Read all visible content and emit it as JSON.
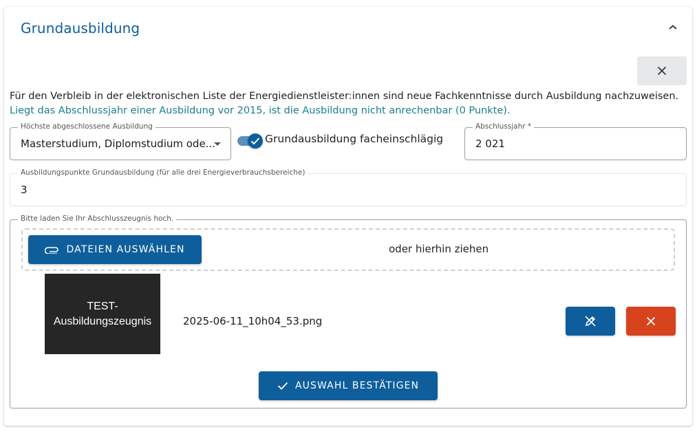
{
  "section": {
    "title": "Grundausbildung",
    "collapse_icon": "chevron-up-icon",
    "close_icon": "close-icon"
  },
  "info": {
    "line1": "Für den Verbleib in der elektronischen Liste der Energiedienstleister:innen sind neue Fachkenntnisse durch Ausbildung nachzuweisen.",
    "line2": "Liegt das Abschlussjahr einer Ausbildung vor 2015, ist die Ausbildung nicht anrechenbar (0 Punkte)."
  },
  "form": {
    "education": {
      "label": "Höchste abgeschlossene Ausbildung",
      "value": "Masterstudium, Diplomstudium ode..."
    },
    "relevant_toggle": {
      "label": "Grundausbildung facheinschlägig",
      "checked": true
    },
    "year": {
      "label": "Abschlussjahr *",
      "value": "2 021"
    },
    "points": {
      "label": "Ausbildungspunkte Grundausbildung (für alle drei Energieverbrauchsbereiche)",
      "value": "3"
    }
  },
  "upload": {
    "label": "Bitte laden Sie Ihr Abschlusszeugnis hoch.",
    "choose_button": "DATEIEN AUSWÄHLEN",
    "choose_icon": "paperclip-icon",
    "drop_hint": "oder hierhin ziehen",
    "file": {
      "thumbnail_text": "TEST-\nAusbildungszeugnis",
      "name": "2025-06-11_10h04_53.png",
      "edit_icon": "edit-pen-icon",
      "delete_icon": "close-icon"
    },
    "confirm_button": "AUSWAHL BESTÄTIGEN",
    "confirm_icon": "check-icon"
  },
  "colors": {
    "primary": "#0e5e9c",
    "danger": "#d6431c",
    "info_text": "#1a7e8a"
  }
}
